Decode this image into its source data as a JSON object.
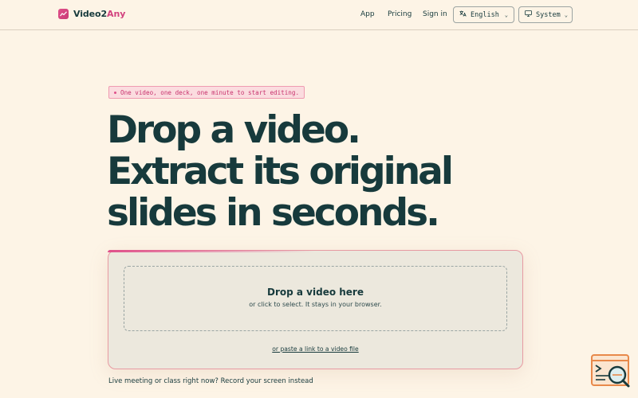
{
  "brand": {
    "name_main": "Video2",
    "name_accent": "Any"
  },
  "nav": {
    "app": "App",
    "pricing": "Pricing",
    "signin": "Sign in",
    "language": "English",
    "theme": "System"
  },
  "tagline": "One video, one deck, one minute to start editing.",
  "hero": {
    "line1": "Drop a video.",
    "line2": "Extract its original",
    "line3": "slides in seconds."
  },
  "dropzone": {
    "title": "Drop a video here",
    "subtitle": "or click to select. It stays in your browser.",
    "paste_link": "or paste a link to a video file"
  },
  "record_line": "Live meeting or class right now? Record your screen instead",
  "colors": {
    "accent": "#d2427e",
    "ink": "#173a3c",
    "background": "#fdf4e6"
  },
  "icons": [
    "chart-logo-icon",
    "translate-icon",
    "chevron-down-icon",
    "monitor-icon",
    "slides-search-icon"
  ]
}
